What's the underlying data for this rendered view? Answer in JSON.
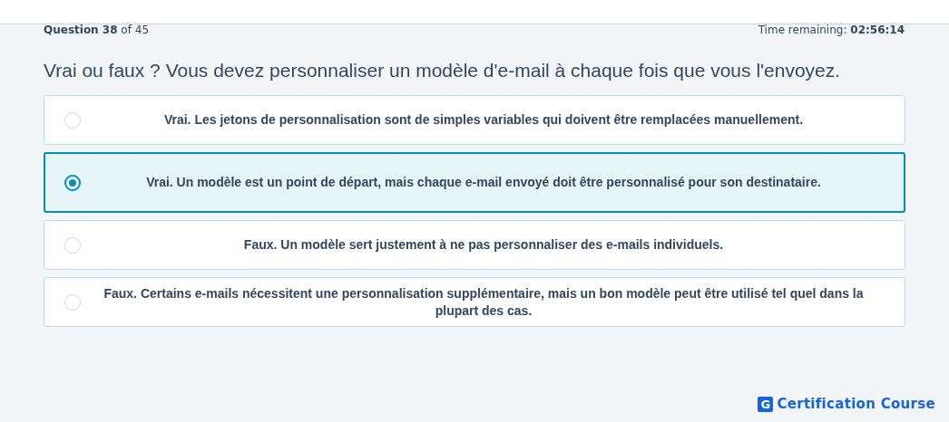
{
  "progress": {
    "label": "Question",
    "number": "38",
    "of": "of 45"
  },
  "timer": {
    "label": "Time remaining:",
    "value": "02:56:14"
  },
  "question": "Vrai ou faux ? Vous devez personnaliser un modèle d'e-mail à chaque fois que vous l'envoyez.",
  "options": [
    {
      "text": "Vrai. Les jetons de personnalisation sont de simples variables qui doivent être remplacées manuellement.",
      "selected": false
    },
    {
      "text": "Vrai. Un modèle est un point de départ, mais chaque e-mail envoyé doit être personnalisé pour son destinataire.",
      "selected": true
    },
    {
      "text": "Faux. Un modèle sert justement à ne pas personnaliser des e-mails individuels.",
      "selected": false
    },
    {
      "text": "Faux. Certains e-mails nécessitent une personnalisation supplémentaire, mais un bon modèle peut être utilisé tel quel dans la plupart des cas.",
      "selected": false
    }
  ],
  "brand": {
    "mark": "G",
    "name": "Certification Course"
  }
}
